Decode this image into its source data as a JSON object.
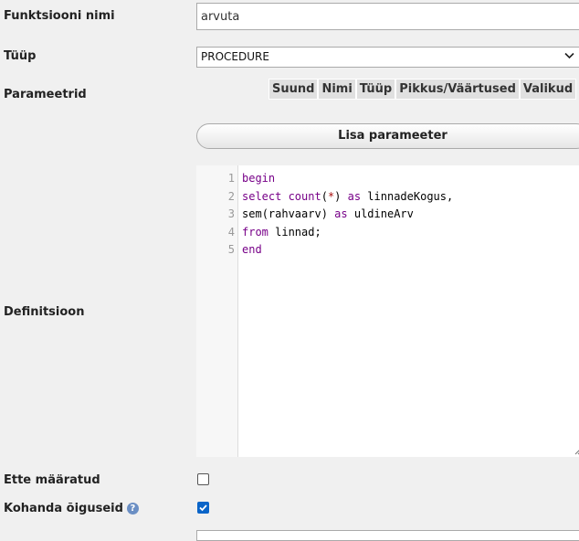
{
  "form": {
    "function_name_label": "Funktsiooni nimi",
    "function_name_value": "arvuta",
    "type_label": "Tüüp",
    "type_value": "PROCEDURE",
    "parameters_label": "Parameetrid",
    "param_columns": [
      "Suund",
      "Nimi",
      "Tüüp",
      "Pikkus/Väärtused",
      "Valikud"
    ],
    "add_param_button": "Lisa parameeter",
    "definition_label": "Definitsioon",
    "predetermined_label": "Ette määratud",
    "predetermined_checked": false,
    "adjust_privileges_label": "Kohanda õiguseid",
    "adjust_privileges_checked": true
  },
  "editor": {
    "lines": [
      {
        "num": "1",
        "tokens": [
          {
            "t": "begin",
            "c": "kw"
          }
        ]
      },
      {
        "num": "2",
        "tokens": [
          {
            "t": "select ",
            "c": "kw"
          },
          {
            "t": "count",
            "c": "kw"
          },
          {
            "t": "(",
            "c": "fn"
          },
          {
            "t": "*",
            "c": "op"
          },
          {
            "t": ") ",
            "c": "fn"
          },
          {
            "t": "as",
            "c": "kw"
          },
          {
            "t": " linnadeKogus,",
            "c": "fn"
          }
        ]
      },
      {
        "num": "3",
        "tokens": [
          {
            "t": "sem",
            "c": "fn"
          },
          {
            "t": "(rahvaarv) ",
            "c": "fn"
          },
          {
            "t": "as",
            "c": "kw"
          },
          {
            "t": " uldineArv",
            "c": "fn"
          }
        ]
      },
      {
        "num": "4",
        "tokens": [
          {
            "t": "from",
            "c": "kw"
          },
          {
            "t": " linnad;",
            "c": "fn"
          }
        ]
      },
      {
        "num": "5",
        "tokens": [
          {
            "t": "end",
            "c": "kw"
          }
        ]
      }
    ]
  },
  "icons": {
    "help": "help-icon",
    "chevron": "chevron-down-icon",
    "resize": "resize-handle-icon"
  }
}
